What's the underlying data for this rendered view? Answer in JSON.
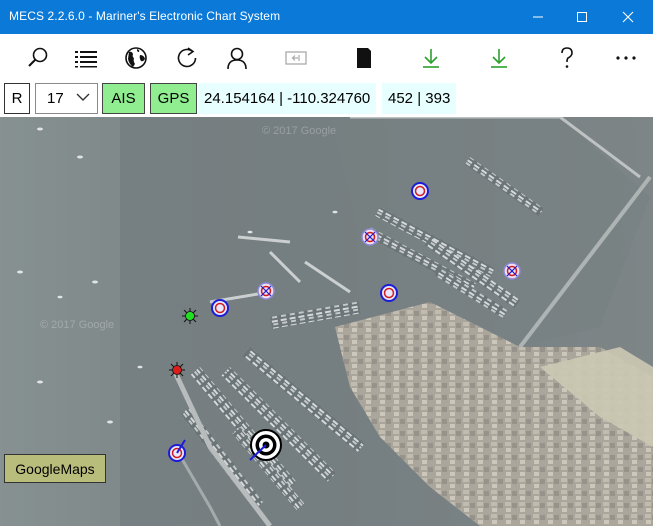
{
  "window": {
    "title": "MECS 2.2.6.0 - Mariner's Electronic Chart System"
  },
  "toolbar": {
    "icons": [
      "search-icon",
      "list-icon",
      "globe-icon",
      "refresh-icon",
      "user-icon",
      "screen-icon",
      "sd-card-icon",
      "download-icon",
      "download-icon",
      "help-icon",
      "more-icon"
    ],
    "download_color": "#2ca02c"
  },
  "controls": {
    "r_label": "R",
    "zoom_value": "17",
    "ais_label": "AIS",
    "gps_label": "GPS",
    "coordinates": "24.154164 | -110.324760",
    "pixel_readout": "452 | 393",
    "toggle_color": "#90ee90"
  },
  "map": {
    "googlemaps_label": "GoogleMaps",
    "watermark": "© 2017 Google"
  }
}
